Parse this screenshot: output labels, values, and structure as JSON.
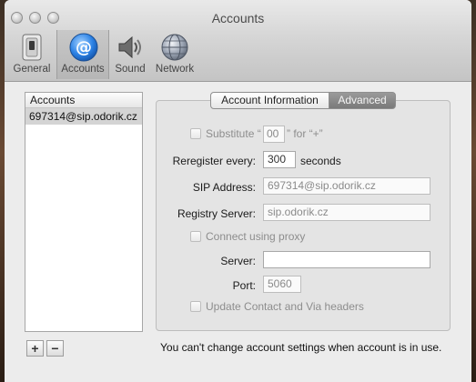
{
  "window": {
    "title": "Accounts"
  },
  "toolbar": {
    "items": [
      {
        "label": "General",
        "icon": "switch-icon"
      },
      {
        "label": "Accounts",
        "icon": "at-sign-icon",
        "selected": true
      },
      {
        "label": "Sound",
        "icon": "speaker-icon"
      },
      {
        "label": "Network",
        "icon": "globe-icon"
      }
    ]
  },
  "accounts": {
    "header": "Accounts",
    "items": [
      "697314@sip.odorik.cz"
    ],
    "add_label": "+",
    "remove_label": "−"
  },
  "tabs": {
    "items": [
      "Account Information",
      "Advanced"
    ],
    "selected": "Advanced"
  },
  "advanced": {
    "substitute": {
      "label_pre": "Substitute “",
      "value": "00",
      "label_post": "” for “+”",
      "checked": false
    },
    "reregister": {
      "label": "Reregister every:",
      "value": "300",
      "unit": "seconds"
    },
    "sip_address": {
      "label": "SIP Address:",
      "value": "697314@sip.odorik.cz"
    },
    "registry_server": {
      "label": "Registry Server:",
      "value": "sip.odorik.cz"
    },
    "proxy": {
      "label": "Connect using proxy",
      "checked": false
    },
    "server": {
      "label": "Server:",
      "value": ""
    },
    "port": {
      "label": "Port:",
      "value": "5060"
    },
    "update_headers": {
      "label": "Update Contact and Via headers",
      "checked": false
    }
  },
  "status_text": "You can't change account settings when account is in use."
}
